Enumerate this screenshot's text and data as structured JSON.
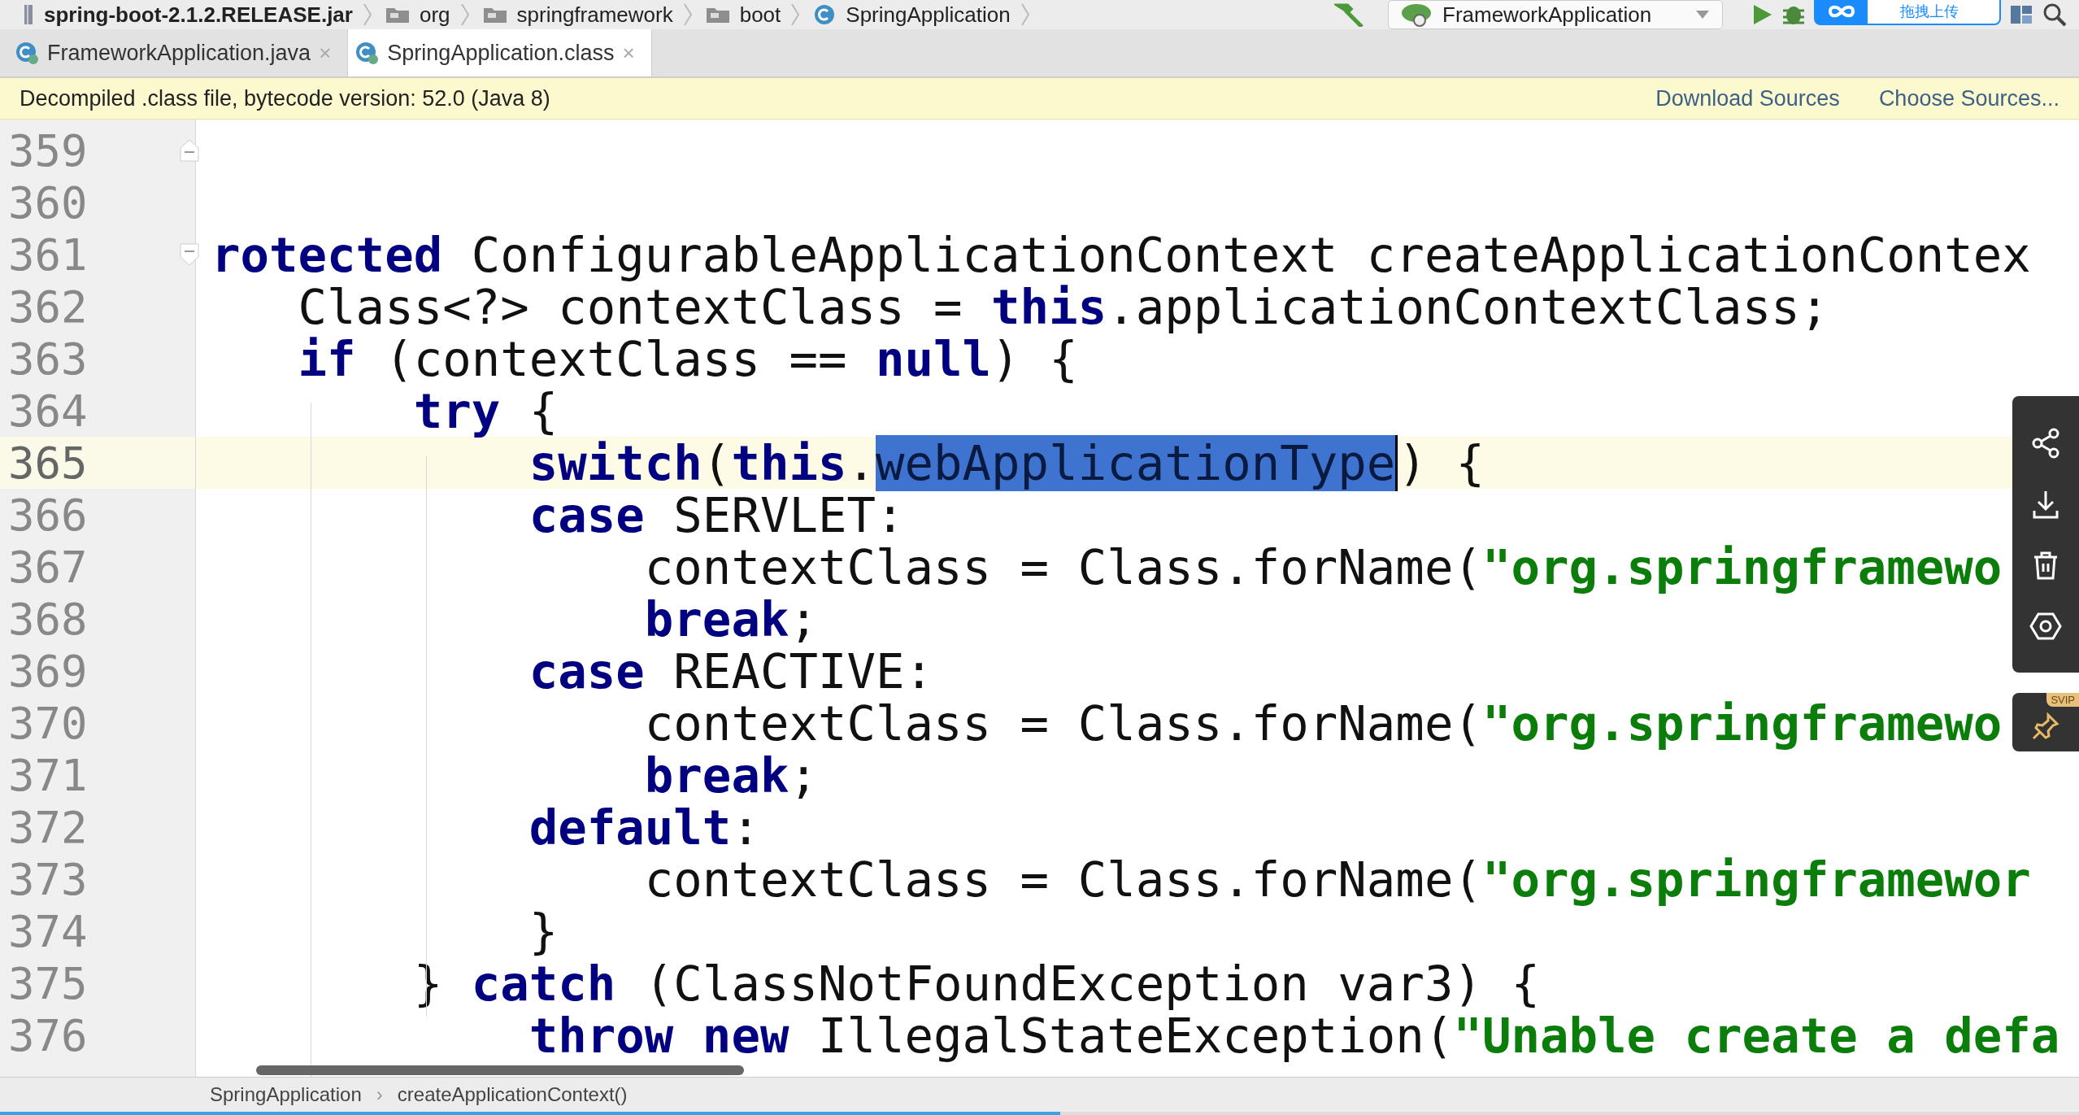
{
  "breadcrumbs": [
    {
      "label": "spring-boot-2.1.2.RELEASE.jar",
      "kind": "jar"
    },
    {
      "label": "org",
      "kind": "package"
    },
    {
      "label": "springframework",
      "kind": "package"
    },
    {
      "label": "boot",
      "kind": "package"
    },
    {
      "label": "SpringApplication",
      "kind": "class"
    }
  ],
  "run_config": {
    "label": "FrameworkApplication"
  },
  "upload_widget": {
    "label": "拖拽上传"
  },
  "tabs": [
    {
      "label": "FrameworkApplication.java",
      "selected": false,
      "close": "×"
    },
    {
      "label": "SpringApplication.class",
      "selected": true,
      "close": "×"
    }
  ],
  "banner": {
    "message": "Decompiled .class file, bytecode version: 52.0 (Java 8)",
    "links": [
      "Download Sources",
      "Choose Sources..."
    ]
  },
  "editor": {
    "lines": [
      {
        "number": "359",
        "current": false,
        "kind": "fold_end"
      },
      {
        "number": "360",
        "current": false
      },
      {
        "number": "361",
        "current": false,
        "kind": "fold_start",
        "tokens": [
          {
            "kind": "keyword",
            "text": "rotected"
          },
          {
            "kind": "plain",
            "text": " ConfigurableApplicationContext createApplicationContex"
          }
        ]
      },
      {
        "number": "362",
        "current": false,
        "tokens": [
          {
            "kind": "plain",
            "text": "   Class<?> contextClass = "
          },
          {
            "kind": "keyword",
            "text": "this"
          },
          {
            "kind": "plain",
            "text": ".applicationContextClass;"
          }
        ]
      },
      {
        "number": "363",
        "current": false,
        "tokens": [
          {
            "kind": "keyword",
            "text": "   if"
          },
          {
            "kind": "plain",
            "text": " (contextClass == "
          },
          {
            "kind": "keyword",
            "text": "null"
          },
          {
            "kind": "plain",
            "text": ") {"
          }
        ]
      },
      {
        "number": "364",
        "current": false,
        "tokens": [
          {
            "kind": "keyword",
            "text": "       try"
          },
          {
            "kind": "plain",
            "text": " {"
          }
        ]
      },
      {
        "number": "365",
        "current": true,
        "tokens": [
          {
            "kind": "keyword",
            "text": "           switch"
          },
          {
            "kind": "plain",
            "text": "("
          },
          {
            "kind": "keyword",
            "text": "this"
          },
          {
            "kind": "plain",
            "text": "."
          },
          {
            "kind": "selected",
            "text": "webApplicationType"
          },
          {
            "kind": "plain",
            "text": ") {"
          }
        ]
      },
      {
        "number": "366",
        "current": false,
        "tokens": [
          {
            "kind": "keyword",
            "text": "           case"
          },
          {
            "kind": "plain",
            "text": " SERVLET:"
          }
        ]
      },
      {
        "number": "367",
        "current": false,
        "tokens": [
          {
            "kind": "plain",
            "text": "               contextClass = Class.forName("
          },
          {
            "kind": "string",
            "text": "\"org.springframewo"
          }
        ]
      },
      {
        "number": "368",
        "current": false,
        "tokens": [
          {
            "kind": "keyword",
            "text": "               break"
          },
          {
            "kind": "plain",
            "text": ";"
          }
        ]
      },
      {
        "number": "369",
        "current": false,
        "tokens": [
          {
            "kind": "keyword",
            "text": "           case"
          },
          {
            "kind": "plain",
            "text": " REACTIVE:"
          }
        ]
      },
      {
        "number": "370",
        "current": false,
        "tokens": [
          {
            "kind": "plain",
            "text": "               contextClass = Class.forName("
          },
          {
            "kind": "string",
            "text": "\"org.springframewo"
          }
        ]
      },
      {
        "number": "371",
        "current": false,
        "tokens": [
          {
            "kind": "keyword",
            "text": "               break"
          },
          {
            "kind": "plain",
            "text": ";"
          }
        ]
      },
      {
        "number": "372",
        "current": false,
        "tokens": [
          {
            "kind": "keyword",
            "text": "           default"
          },
          {
            "kind": "plain",
            "text": ":"
          }
        ]
      },
      {
        "number": "373",
        "current": false,
        "tokens": [
          {
            "kind": "plain",
            "text": "               contextClass = Class.forName("
          },
          {
            "kind": "string",
            "text": "\"org.springframewor"
          }
        ]
      },
      {
        "number": "374",
        "current": false,
        "tokens": [
          {
            "kind": "plain",
            "text": "           }"
          }
        ]
      },
      {
        "number": "375",
        "current": false,
        "tokens": [
          {
            "kind": "plain",
            "text": "       } "
          },
          {
            "kind": "keyword",
            "text": "catch"
          },
          {
            "kind": "plain",
            "text": " (ClassNotFoundException var3) {"
          }
        ]
      },
      {
        "number": "376",
        "current": false,
        "tokens": [
          {
            "kind": "keyword",
            "text": "           throw new"
          },
          {
            "kind": "plain",
            "text": " IllegalStateException("
          },
          {
            "kind": "string",
            "text": "\"Unable create a defa"
          }
        ]
      }
    ]
  },
  "status_path": [
    "SpringApplication",
    "createApplicationContext()"
  ],
  "status_separator": "›",
  "side_toolbar": {
    "badge": "SVIP"
  },
  "progress": {
    "level": 0.51
  }
}
